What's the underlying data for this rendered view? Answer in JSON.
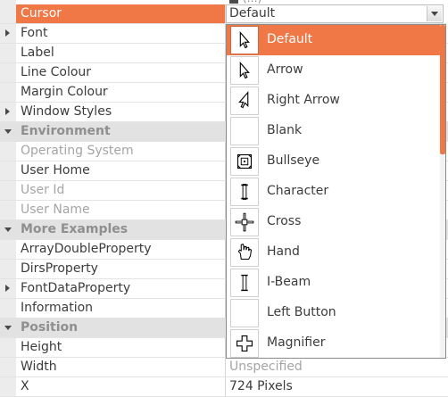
{
  "top_value_partial": "(…)",
  "properties": [
    {
      "type": "property",
      "name": "Cursor",
      "value": "",
      "expander": "",
      "state": "selected"
    },
    {
      "type": "property",
      "name": "Font",
      "value": "",
      "expander": "collapsed",
      "state": "normal"
    },
    {
      "type": "property",
      "name": "Label",
      "value": "",
      "expander": "",
      "state": "normal"
    },
    {
      "type": "property",
      "name": "Line Colour",
      "value": "",
      "expander": "",
      "state": "normal"
    },
    {
      "type": "property",
      "name": "Margin Colour",
      "value": "",
      "expander": "",
      "state": "normal"
    },
    {
      "type": "property",
      "name": "Window Styles",
      "value": "",
      "expander": "collapsed",
      "state": "normal"
    },
    {
      "type": "category",
      "name": "Environment",
      "value": "",
      "expander": "expanded",
      "state": "normal"
    },
    {
      "type": "property",
      "name": "Operating System",
      "value": "",
      "expander": "",
      "state": "disabled"
    },
    {
      "type": "property",
      "name": "User Home",
      "value": "",
      "expander": "",
      "state": "normal"
    },
    {
      "type": "property",
      "name": "User Id",
      "value": "",
      "expander": "",
      "state": "disabled"
    },
    {
      "type": "property",
      "name": "User Name",
      "value": "",
      "expander": "",
      "state": "disabled"
    },
    {
      "type": "category",
      "name": "More Examples",
      "value": "",
      "expander": "expanded",
      "state": "normal"
    },
    {
      "type": "property",
      "name": "ArrayDoubleProperty",
      "value": "",
      "expander": "",
      "state": "normal"
    },
    {
      "type": "property",
      "name": "DirsProperty",
      "value": "",
      "expander": "",
      "state": "normal"
    },
    {
      "type": "property",
      "name": "FontDataProperty",
      "value": "",
      "expander": "collapsed",
      "state": "normal"
    },
    {
      "type": "property",
      "name": "Information",
      "value": "",
      "expander": "",
      "state": "normal"
    },
    {
      "type": "category",
      "name": "Position",
      "value": "",
      "expander": "expanded",
      "state": "normal"
    },
    {
      "type": "property",
      "name": "Height",
      "value": "",
      "expander": "",
      "state": "normal"
    },
    {
      "type": "property",
      "name": "Width",
      "value": "Unspecified",
      "expander": "",
      "state": "value-disabled"
    },
    {
      "type": "property",
      "name": "X",
      "value": "724 Pixels",
      "expander": "",
      "state": "normal"
    }
  ],
  "combo": {
    "value": "Default"
  },
  "dropdown": {
    "items": [
      {
        "label": "Default",
        "icon": "default-cursor-icon",
        "selected": true
      },
      {
        "label": "Arrow",
        "icon": "arrow-cursor-icon",
        "selected": false
      },
      {
        "label": "Right Arrow",
        "icon": "right-arrow-cursor-icon",
        "selected": false
      },
      {
        "label": "Blank",
        "icon": "blank-cursor-icon",
        "selected": false
      },
      {
        "label": "Bullseye",
        "icon": "bullseye-cursor-icon",
        "selected": false
      },
      {
        "label": "Character",
        "icon": "character-cursor-icon",
        "selected": false
      },
      {
        "label": "Cross",
        "icon": "cross-cursor-icon",
        "selected": false
      },
      {
        "label": "Hand",
        "icon": "hand-cursor-icon",
        "selected": false
      },
      {
        "label": "I-Beam",
        "icon": "ibeam-cursor-icon",
        "selected": false
      },
      {
        "label": "Left Button",
        "icon": "left-button-cursor-icon",
        "selected": false
      },
      {
        "label": "Magnifier",
        "icon": "magnifier-cursor-icon",
        "selected": false
      }
    ]
  },
  "colors": {
    "accent": "#f07746",
    "category_bg": "#e2e2e2",
    "disabled_text": "#a5a5a5"
  }
}
